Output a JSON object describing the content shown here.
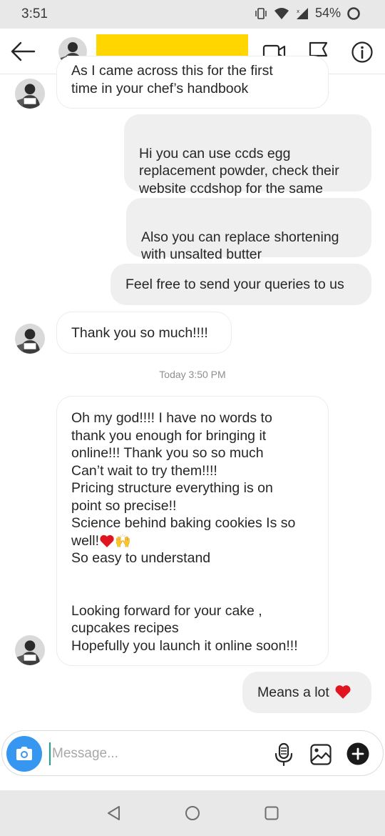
{
  "status_bar": {
    "time": "3:51",
    "battery": "54%"
  },
  "header": {
    "contact_name_redacted": true
  },
  "messages": [
    {
      "id": "m1",
      "direction": "in",
      "lines": [
        "As I came across this for the first",
        "time in your chef’s handbook"
      ]
    },
    {
      "id": "m2",
      "direction": "out",
      "text": "Hi you can use ccds egg\nreplacement powder, check their\nwebsite ccdshop for the same"
    },
    {
      "id": "m3",
      "direction": "out",
      "text": "Also you can replace shortening\nwith unsalted butter"
    },
    {
      "id": "m4",
      "direction": "out",
      "text": "Feel free to send your queries to us"
    },
    {
      "id": "m5",
      "direction": "in",
      "text": "Thank you so much!!!!"
    },
    {
      "id": "m6",
      "direction": "in",
      "part1": "Oh my god!!!! I have no words to\nthank you enough for bringing it\nonline!!! Thank you  so so much\nCan’t wait to try them!!!!\nPricing structure everything is on\npoint so precise!!\nScience behind baking cookies Is so\nwell!",
      "emoji": "🙌",
      "part2": "So easy to understand\n\n\nLooking forward for your cake ,\ncupcakes recipes\nHopefully you launch it online soon!!!"
    },
    {
      "id": "m7",
      "direction": "out",
      "text": "Means a lot"
    }
  ],
  "timestamp": "Today 3:50 PM",
  "composer": {
    "placeholder": "Message..."
  },
  "colors": {
    "heart": "#e0151f",
    "camera_button": "#3797f0",
    "redaction": "#ffd600",
    "cursor": "#19a594"
  },
  "icons": [
    "back-arrow-icon",
    "video-call-icon",
    "flag-icon",
    "info-icon",
    "camera-icon",
    "microphone-icon",
    "gallery-icon",
    "plus-icon",
    "raising-hands-emoji",
    "heart-emoji"
  ]
}
